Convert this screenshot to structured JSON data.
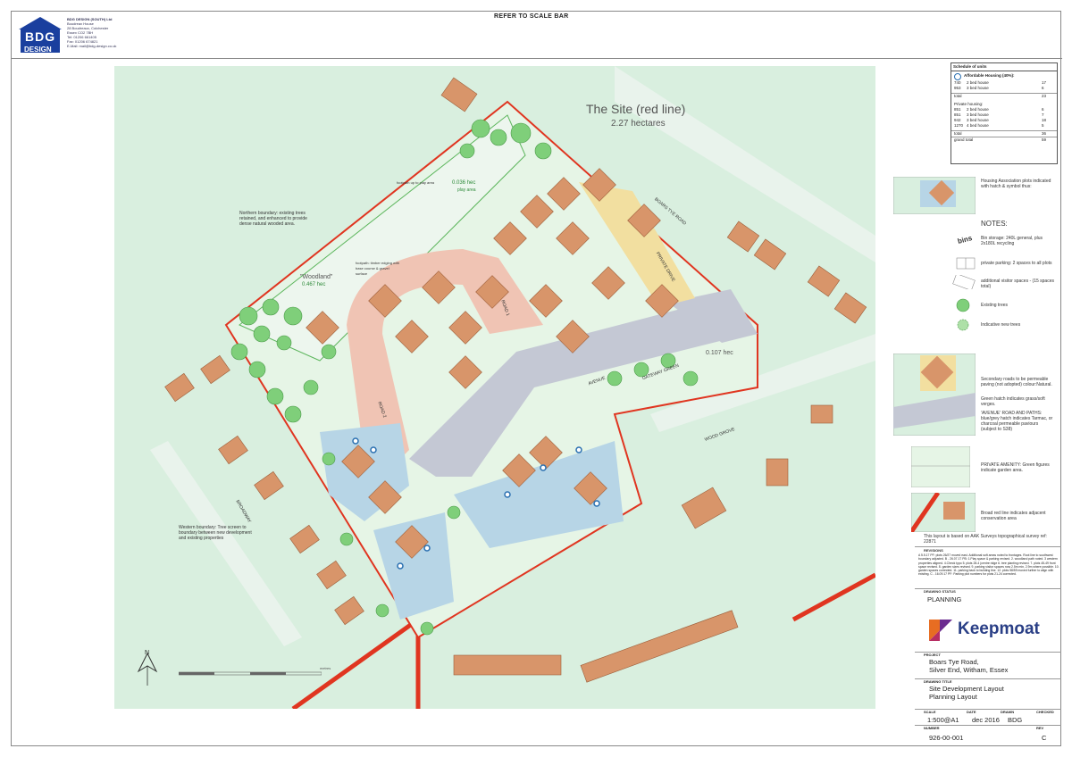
{
  "header": {
    "refer": "REFER TO SCALE BAR",
    "logo_word1": "BDG",
    "logo_word2": "DESIGN",
    "company": "BDG DESIGN (SOUTH) Ltd",
    "address1": "Boudreax House",
    "address2": "28 Boudreaux, Colchester",
    "address3": "Essex CO2 7BH",
    "tel": "Tel: 01206 661405",
    "fax": "Fax: 01206 674821",
    "email": "E-Mail: mail@bdg-design.co.uk"
  },
  "map": {
    "site_title": "The Site (red line)",
    "site_area": "2.27 hectares",
    "play_area": "0.036 hec",
    "play_area_label": "play area",
    "woodland_label": "\"Woodland\"",
    "woodland_area": "0.467 hec",
    "green_area": "0.107 hec",
    "northern_boundary": "Northern boundary: existing trees retained, and enhanced to provide dense natural wooded area.",
    "western_boundary": "Western boundary: Tree screen to boundary between new development and existing properties",
    "roads": {
      "boars": "BOARS TYE ROAD",
      "private_drive": "PRIVATE DRIVE",
      "road1": "ROAD 1",
      "road2": "ROAD 2",
      "avenue": "AVENUE",
      "gateway": "GATEWAY GREEN",
      "wood_grove": "WOOD GROVE",
      "broadway": "BROADWAY"
    },
    "footpath1": "footpath up to play area",
    "footpath2": "footpath: timber edging with base course & gravel surface",
    "north": "N",
    "scale_units": "metres"
  },
  "schedule": {
    "title": "Schedule of units",
    "affordable_heading": "Affordable Housing (40%):",
    "affordable": [
      {
        "size": "740",
        "type": "2 bed house",
        "count": "17"
      },
      {
        "size": "953",
        "type": "3 bed house",
        "count": "6"
      }
    ],
    "affordable_total_label": "total",
    "affordable_total": "23",
    "private_heading": "Private housing:",
    "private": [
      {
        "size": "851",
        "type": "2 bed house",
        "count": "6"
      },
      {
        "size": "851",
        "type": "3 bed house",
        "count": "7"
      },
      {
        "size": "942",
        "type": "3 bed house",
        "count": "18"
      },
      {
        "size": "1270",
        "type": "4 bed house",
        "count": "5"
      }
    ],
    "private_total_label": "total",
    "private_total": "36",
    "grand_total_label": "grand total",
    "grand_total": "59"
  },
  "legend": {
    "housing_assoc": "Housing Association plots indicated with hatch & symbol thus:",
    "notes_title": "NOTES:",
    "bins": "bins",
    "bin_storage": "Bin storage: 240L general, plus 2x180L recycling",
    "parking": "private parking: 2 spaces to all plots",
    "visitor": "additional visitor spaces - (15 spaces total)",
    "existing_trees": "Existing trees",
    "new_trees": "Indicative new trees",
    "secondary_roads": "Secondary roads to be permeable paving (not adopted) colour:Natural.",
    "green_hatch": "Green hatch indicates grass/soft verges.",
    "avenue_note": "'AVENUE' ROAD AND PATHS: blue/grey hatch indicates Tarmac, or charcoal permeable paviours (subject to S38)",
    "private_amenity": "PRIVATE AMENITY: Green figures indicate garden area.",
    "red_line": "Broad red line indicates adjacent conservation area",
    "survey": "This layout is based on AAK Surveys topographical survey ref: 22871"
  },
  "titleblock": {
    "revisions_label": "REVISIONS",
    "revisions_text": "A 5.5.17 PF: plots 26/27 moved east. Additional soft areas noted to frontages. Root line to southwest boundary adjusted. B - 26.07.17 PB: 1.Play space & parking revised. 2. woodland path noted. 3 western properties aligned. 4.Check typo 5. plots 28-4 (centre ridge 6. tree planting revised. 7. plots 45-49 front space revised. 8. garden sizes revised. 9. parking visitor spaces now 2.5m min, 2.9m where possible. 10. garden spaces corrected. 11. parking back to building line. 12. plots 58/59 moved further to align with existing. C - 16.09.17 PF: Parking plot numbers for plots 21-24 corrected.",
    "drawing_status_label": "DRAWING STATUS",
    "drawing_status": "PLANNING",
    "company": "Keepmoat",
    "project_label": "PROJECT",
    "project_line1": "Boars Tye Road,",
    "project_line2": "Silver End, Witham, Essex",
    "title_label": "DRAWING TITLE",
    "title_line1": "Site Development Layout",
    "title_line2": "Planning Layout",
    "scale_label": "SCALE",
    "scale": "1:500@A1",
    "date_label": "DATE",
    "date": "dec 2016",
    "drawn_label": "DRAWN",
    "drawn": "BDG",
    "checked_label": "CHECKED",
    "checked": "",
    "number_label": "NUMBER",
    "number": "926-00-001",
    "rev_label": "REV",
    "rev": "C"
  },
  "colors": {
    "background_green": "#d9efdf",
    "site_green": "#e6f5e6",
    "road_pink": "#f0c4b4",
    "road_grey": "#c4c8d4",
    "house": "#d8956a",
    "drive": "#f2dfa0",
    "affordable": "#b7d5e6",
    "red_line": "#e03520",
    "tree": "#7fcf7a"
  }
}
